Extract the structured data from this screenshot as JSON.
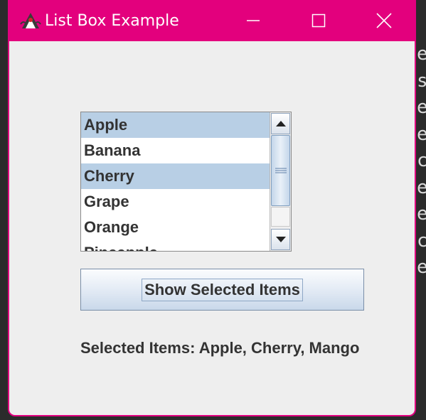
{
  "window": {
    "title": "List Box Example",
    "title_bar_color": "#e3007d",
    "app_icon": "java-duke-icon",
    "controls": [
      "minimize-icon",
      "maximize-icon",
      "close-icon"
    ]
  },
  "listbox": {
    "items": [
      {
        "label": "Apple",
        "selected": true
      },
      {
        "label": "Banana",
        "selected": false
      },
      {
        "label": "Cherry",
        "selected": true
      },
      {
        "label": "Grape",
        "selected": false
      },
      {
        "label": "Orange",
        "selected": false
      },
      {
        "label": "Pineapple",
        "selected": false
      }
    ],
    "selection_color": "#b8cfe5"
  },
  "button": {
    "label": "Show Selected Items"
  },
  "result": {
    "text": "Selected Items: Apple, Cherry, Mango"
  },
  "background_glyphs": [
    "e",
    "s",
    "e",
    "e",
    "c",
    "e",
    "e",
    "c",
    "e"
  ]
}
